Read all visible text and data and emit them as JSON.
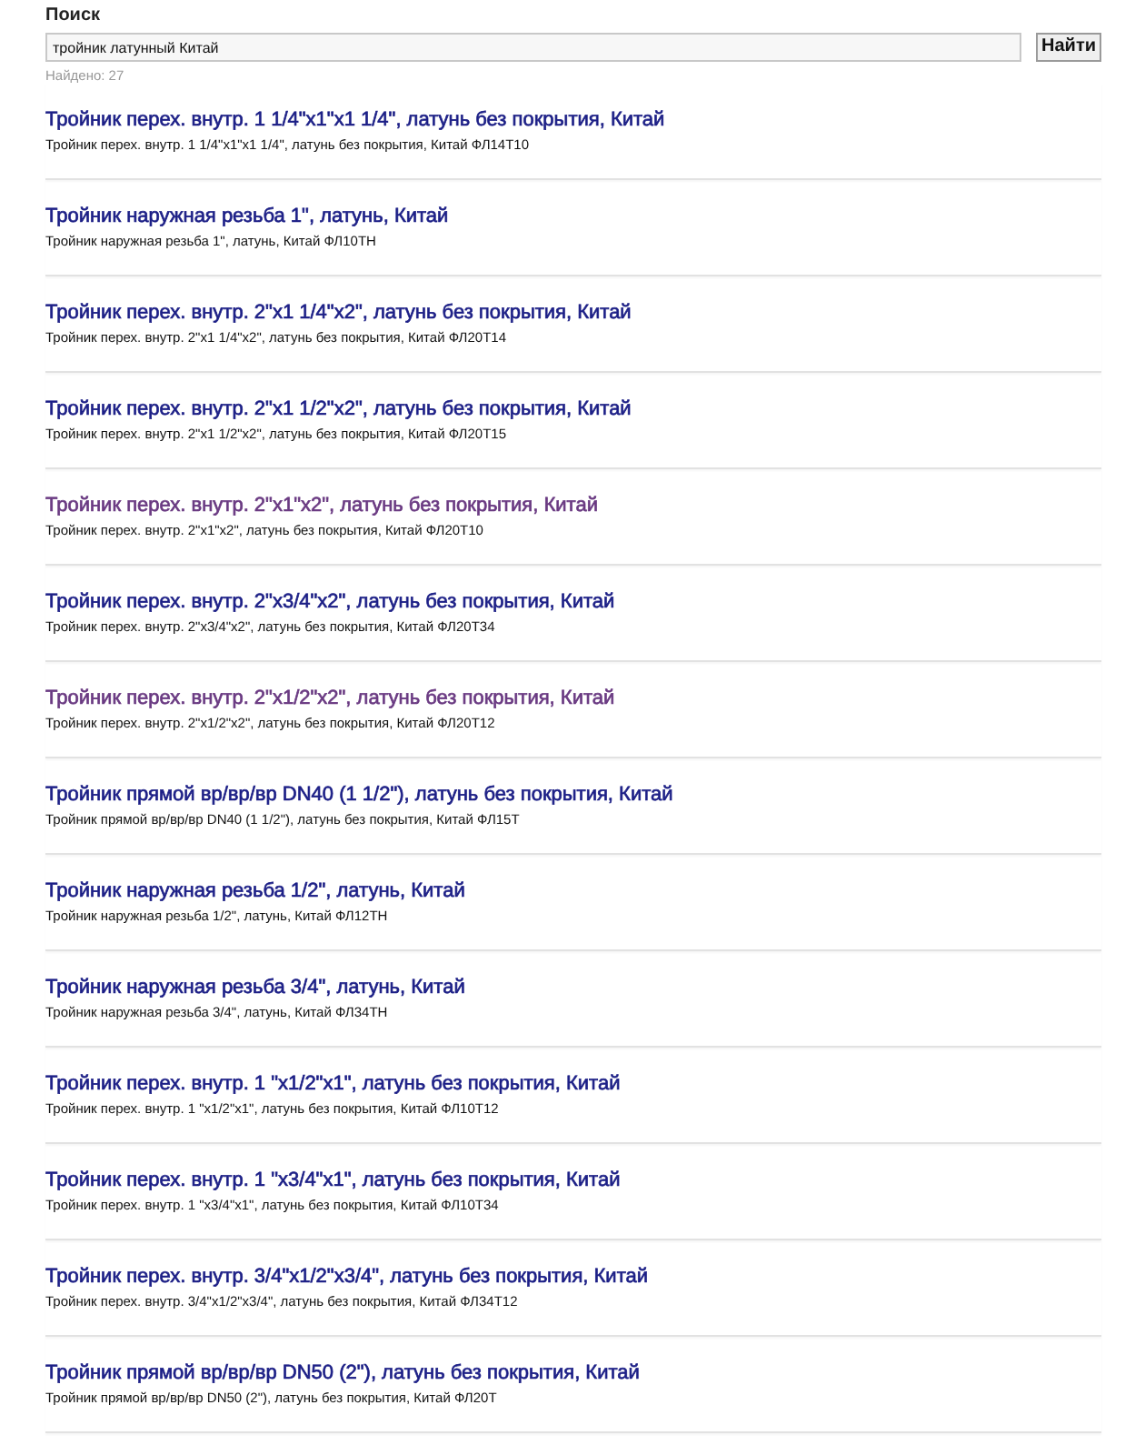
{
  "search": {
    "label": "Поиск",
    "value": "тройник латунный Китай",
    "button": "Найти",
    "found": "Найдено: 27"
  },
  "results": [
    {
      "title": "Тройник перех. внутр. 1 1/4\"x1\"x1 1/4\", латунь без покрытия, Китай",
      "description": "Тройник перех. внутр. 1 1/4\"x1\"x1 1/4\", латунь без покрытия, Китай ФЛ14Т10",
      "visited": false
    },
    {
      "title": "Тройник наружная резьба 1\", латунь, Китай",
      "description": "Тройник наружная резьба 1\", латунь, Китай ФЛ10ТН",
      "visited": false
    },
    {
      "title": "Тройник перех. внутр. 2\"x1 1/4\"x2\", латунь без покрытия, Китай",
      "description": "Тройник перех. внутр. 2\"x1 1/4\"x2\", латунь без покрытия, Китай ФЛ20Т14",
      "visited": false
    },
    {
      "title": "Тройник перех. внутр. 2\"x1 1/2\"x2\", латунь без покрытия, Китай",
      "description": "Тройник перех. внутр. 2\"x1 1/2\"x2\", латунь без покрытия, Китай ФЛ20Т15",
      "visited": false
    },
    {
      "title": "Тройник перех. внутр. 2\"x1\"x2\", латунь без покрытия, Китай",
      "description": "Тройник перех. внутр. 2\"x1\"x2\", латунь без покрытия, Китай ФЛ20Т10",
      "visited": true
    },
    {
      "title": "Тройник перех. внутр. 2\"x3/4\"x2\", латунь без покрытия, Китай",
      "description": "Тройник перех. внутр. 2\"x3/4\"x2\", латунь без покрытия, Китай ФЛ20Т34",
      "visited": false
    },
    {
      "title": "Тройник перех. внутр. 2\"x1/2\"x2\", латунь без покрытия, Китай",
      "description": "Тройник перех. внутр. 2\"x1/2\"x2\", латунь без покрытия, Китай ФЛ20Т12",
      "visited": true
    },
    {
      "title": "Тройник прямой вр/вр/вр DN40 (1 1/2\"), латунь без покрытия, Китай",
      "description": "Тройник прямой вр/вр/вр DN40 (1 1/2\"), латунь без покрытия, Китай ФЛ15Т",
      "visited": false
    },
    {
      "title": "Тройник наружная резьба 1/2\", латунь, Китай",
      "description": "Тройник наружная резьба 1/2\", латунь, Китай ФЛ12ТН",
      "visited": false
    },
    {
      "title": "Тройник наружная резьба 3/4\", латунь, Китай",
      "description": "Тройник наружная резьба 3/4\", латунь, Китай ФЛ34ТН",
      "visited": false
    },
    {
      "title": "Тройник перех. внутр. 1 \"x1/2\"x1\", латунь без покрытия, Китай",
      "description": "Тройник перех. внутр. 1 \"x1/2\"x1\", латунь без покрытия, Китай ФЛ10Т12",
      "visited": false
    },
    {
      "title": "Тройник перех. внутр. 1 \"x3/4\"x1\", латунь без покрытия, Китай",
      "description": "Тройник перех. внутр. 1 \"x3/4\"x1\", латунь без покрытия, Китай ФЛ10Т34",
      "visited": false
    },
    {
      "title": "Тройник перех. внутр. 3/4\"x1/2\"x3/4\", латунь без покрытия, Китай",
      "description": "Тройник перех. внутр. 3/4\"x1/2\"x3/4\", латунь без покрытия, Китай ФЛ34Т12",
      "visited": false
    },
    {
      "title": "Тройник прямой вр/вр/вр DN50 (2\"), латунь без покрытия, Китай",
      "description": "Тройник прямой вр/вр/вр DN50 (2\"), латунь без покрытия, Китай ФЛ20Т",
      "visited": false
    }
  ]
}
